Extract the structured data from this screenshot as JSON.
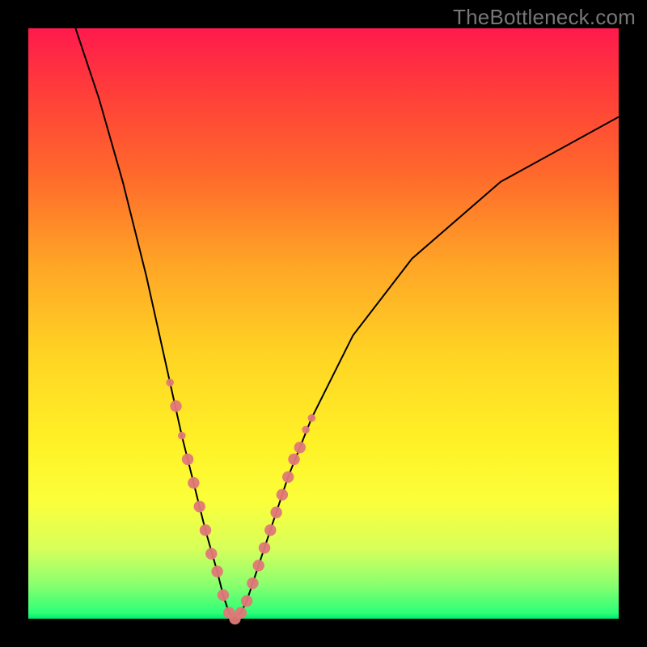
{
  "watermark": "TheBottleneck.com",
  "chart_data": {
    "type": "line",
    "title": "",
    "xlabel": "",
    "ylabel": "",
    "xlim": [
      0,
      100
    ],
    "ylim": [
      0,
      100
    ],
    "series": [
      {
        "name": "curve",
        "x": [
          8,
          12,
          16,
          20,
          24,
          26,
          28,
          30,
          32,
          33,
          34,
          35,
          36,
          37,
          38,
          40,
          44,
          48,
          55,
          65,
          80,
          100
        ],
        "y": [
          100,
          88,
          74,
          58,
          40,
          31,
          23,
          15,
          8,
          4,
          1,
          0,
          1,
          3,
          6,
          12,
          24,
          34,
          48,
          61,
          74,
          85
        ]
      }
    ],
    "markers": [
      {
        "x": 24,
        "y": 40,
        "r": 2
      },
      {
        "x": 25,
        "y": 36,
        "r": 3
      },
      {
        "x": 26,
        "y": 31,
        "r": 2
      },
      {
        "x": 27,
        "y": 27,
        "r": 3
      },
      {
        "x": 28,
        "y": 23,
        "r": 3
      },
      {
        "x": 29,
        "y": 19,
        "r": 3
      },
      {
        "x": 30,
        "y": 15,
        "r": 3
      },
      {
        "x": 31,
        "y": 11,
        "r": 3
      },
      {
        "x": 32,
        "y": 8,
        "r": 3
      },
      {
        "x": 33,
        "y": 4,
        "r": 3
      },
      {
        "x": 34,
        "y": 1,
        "r": 3
      },
      {
        "x": 35,
        "y": 0,
        "r": 3
      },
      {
        "x": 36,
        "y": 1,
        "r": 3
      },
      {
        "x": 37,
        "y": 3,
        "r": 3
      },
      {
        "x": 38,
        "y": 6,
        "r": 3
      },
      {
        "x": 39,
        "y": 9,
        "r": 3
      },
      {
        "x": 40,
        "y": 12,
        "r": 3
      },
      {
        "x": 41,
        "y": 15,
        "r": 3
      },
      {
        "x": 42,
        "y": 18,
        "r": 3
      },
      {
        "x": 43,
        "y": 21,
        "r": 3
      },
      {
        "x": 44,
        "y": 24,
        "r": 3
      },
      {
        "x": 45,
        "y": 27,
        "r": 3
      },
      {
        "x": 46,
        "y": 29,
        "r": 3
      },
      {
        "x": 47,
        "y": 32,
        "r": 2
      },
      {
        "x": 48,
        "y": 34,
        "r": 2
      }
    ]
  },
  "colors": {
    "marker": "#e07878",
    "line": "#000000",
    "frame": "#000000"
  }
}
